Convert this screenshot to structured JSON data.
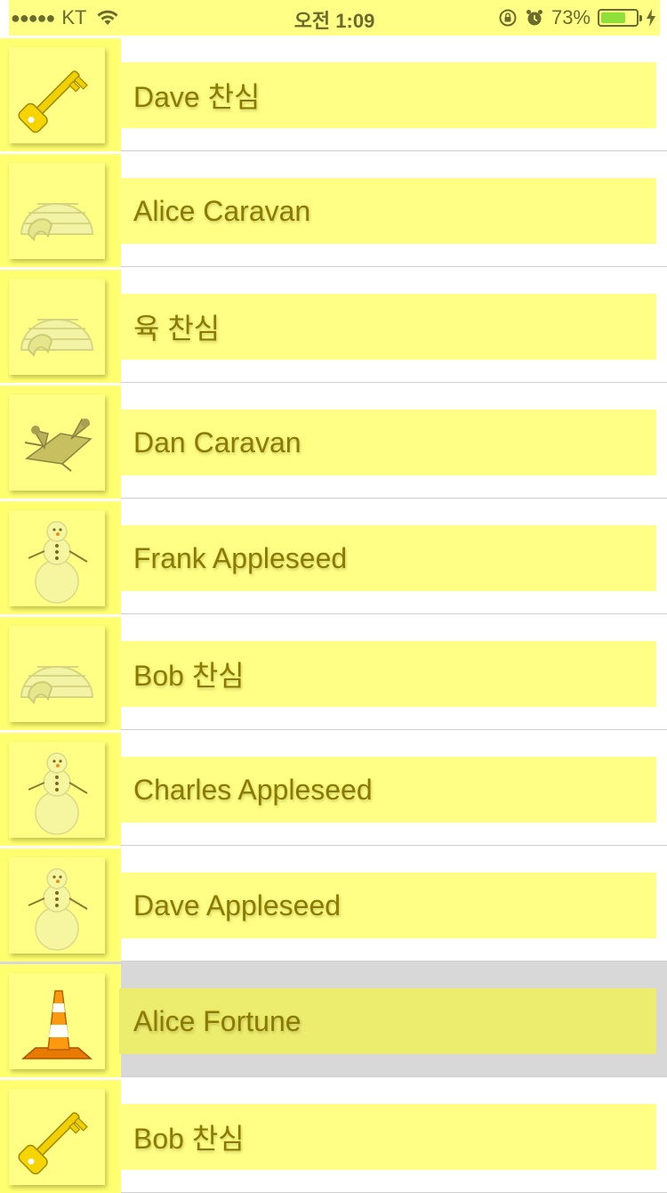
{
  "status_bar": {
    "signal": "●●●●●",
    "carrier": "KT",
    "time": "오전 1:09",
    "battery_percent": "73%",
    "battery_level": 0.73,
    "icons": [
      "wifi-icon",
      "rotation-lock-icon",
      "alarm-icon",
      "battery-icon",
      "charging-bolt-icon"
    ]
  },
  "list": {
    "items": [
      {
        "name": "Dave 찬심",
        "icon": "key-icon"
      },
      {
        "name": "Alice Caravan",
        "icon": "igloo-icon"
      },
      {
        "name": "육 찬심",
        "icon": "igloo-icon"
      },
      {
        "name": "Dan Caravan",
        "icon": "spaceship-icon"
      },
      {
        "name": "Frank Appleseed",
        "icon": "snowman-icon"
      },
      {
        "name": "Bob 찬심",
        "icon": "igloo-icon"
      },
      {
        "name": "Charles Appleseed",
        "icon": "snowman-icon"
      },
      {
        "name": "Dave Appleseed",
        "icon": "snowman-icon"
      },
      {
        "name": "Alice Fortune",
        "icon": "traffic-cone-icon",
        "selected": true
      },
      {
        "name": "Bob 찬심",
        "icon": "key-icon"
      }
    ]
  },
  "colors": {
    "highlight": "#ffff85",
    "text": "#8a7a00",
    "selected_row": "#d8d8d8",
    "battery_fill": "#8fe03a"
  }
}
